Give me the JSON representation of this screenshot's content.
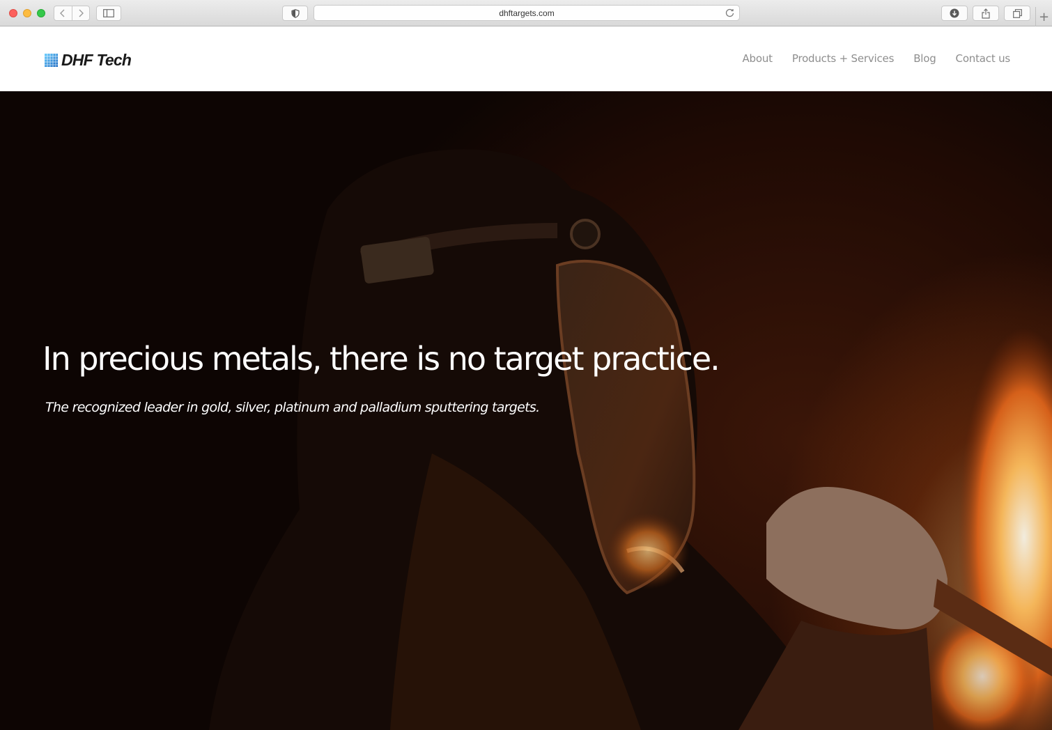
{
  "browser": {
    "url": "dhftargets.com",
    "icons": [
      "back-icon",
      "forward-icon",
      "sidebar-icon",
      "shield-icon",
      "reload-icon",
      "download-icon",
      "share-icon",
      "tabs-icon",
      "plus-icon"
    ]
  },
  "site": {
    "logo_text": "DHF Tech",
    "nav": [
      "About",
      "Products + Services",
      "Blog",
      "Contact us"
    ]
  },
  "hero": {
    "headline": "In precious metals, there is no target practice.",
    "subheadline": "The recognized leader in gold, silver, platinum and palladium sputtering targets."
  },
  "colors": {
    "logo_accent": "#1e88e5",
    "nav_text": "#8e8e8e",
    "hero_text": "#ffffff",
    "fire": "#e8891f"
  }
}
